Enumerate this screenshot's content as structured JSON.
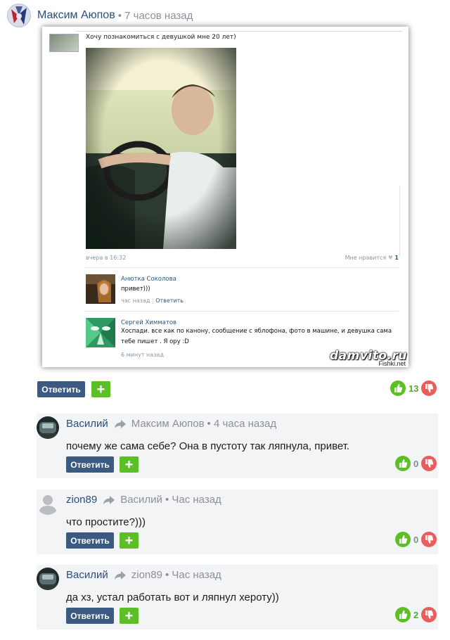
{
  "top_comment": {
    "author": "Максим Аюпов",
    "time": "• 7 часов назад",
    "reply_label": "Ответить",
    "plus_label": "+",
    "votes": "13"
  },
  "screenshot": {
    "post_text": "Хочу познакомиться с девушкой мне 20 лет)",
    "date": "вчера в 16:32",
    "like_label": "Мне нравится",
    "like_count": "1",
    "comments": [
      {
        "name": "Анютка Соколова",
        "text": "привет)))",
        "time": "час назад",
        "reply": "Ответить"
      },
      {
        "name": "Сергей Химматов",
        "text": "Хоспади. все как по канону, сообщение с яблофона, фото в машине, и девушка сама тебе пишет . Я ору :D",
        "time": "6 минут назад"
      }
    ],
    "watermark": "damvito.ru",
    "watermark2": "Fishki.net"
  },
  "replies": [
    {
      "author": "Василий",
      "to": "Максим Аюпов",
      "time": "• 4 часа назад",
      "text": "почему же сама себе? Она в пустоту так ляпнула, привет.",
      "reply_label": "Ответить",
      "plus_label": "+",
      "votes": "0"
    },
    {
      "author": "zion89",
      "to": "Василий",
      "time": "• Час назад",
      "text": "что простите?)))",
      "reply_label": "Ответить",
      "plus_label": "+",
      "votes": "0"
    },
    {
      "author": "Василий",
      "to": "zion89",
      "time": "• Час назад",
      "text": "да хз, устал работать вот и ляпнул хероту))",
      "reply_label": "Ответить",
      "plus_label": "+",
      "votes": "2"
    }
  ],
  "colors": {
    "reply_button": "#3b5a82",
    "plus_button": "#5bbf25",
    "vote_up": "#5bbf25",
    "vote_down": "#ea5d5d",
    "author_link": "#2a4d7a"
  }
}
